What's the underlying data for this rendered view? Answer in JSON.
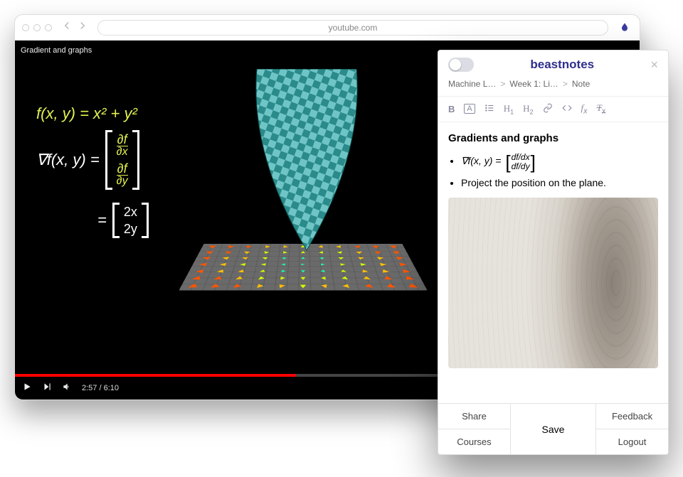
{
  "browser": {
    "url": "youtube.com",
    "extension_icon": "beastnotes-ext-icon"
  },
  "video": {
    "title": "Gradient and graphs",
    "time_elapsed": "2:57",
    "time_total": "6:10",
    "equations": {
      "line1": "f(x, y) = x² + y²",
      "line2_lhs": "∇f(x, y) =",
      "line2_top": "∂f",
      "line2_top_denom": "∂x",
      "line2_bot": "∂f",
      "line2_bot_denom": "∂y",
      "line3_eq": "=",
      "line3_top": "2x",
      "line3_bot": "2y"
    }
  },
  "panel": {
    "brand": "beastnotes",
    "breadcrumbs": [
      "Machine L…",
      "Week 1: Li…",
      "Note"
    ],
    "toolbar": {
      "bold": "B",
      "highlight": "A",
      "list": "list",
      "h1": "H1",
      "h2": "H2",
      "link": "link",
      "code": "code",
      "fx": "fx",
      "clear": "Tx"
    },
    "note": {
      "heading": "Gradients and graphs",
      "item1_prefix": "∇f(x, y) = ",
      "item1_top": "df/dx",
      "item1_bot": "df/dy",
      "item2": "Project the position on the plane."
    },
    "footer": {
      "share": "Share",
      "courses": "Courses",
      "save": "Save",
      "feedback": "Feedback",
      "logout": "Logout"
    }
  }
}
